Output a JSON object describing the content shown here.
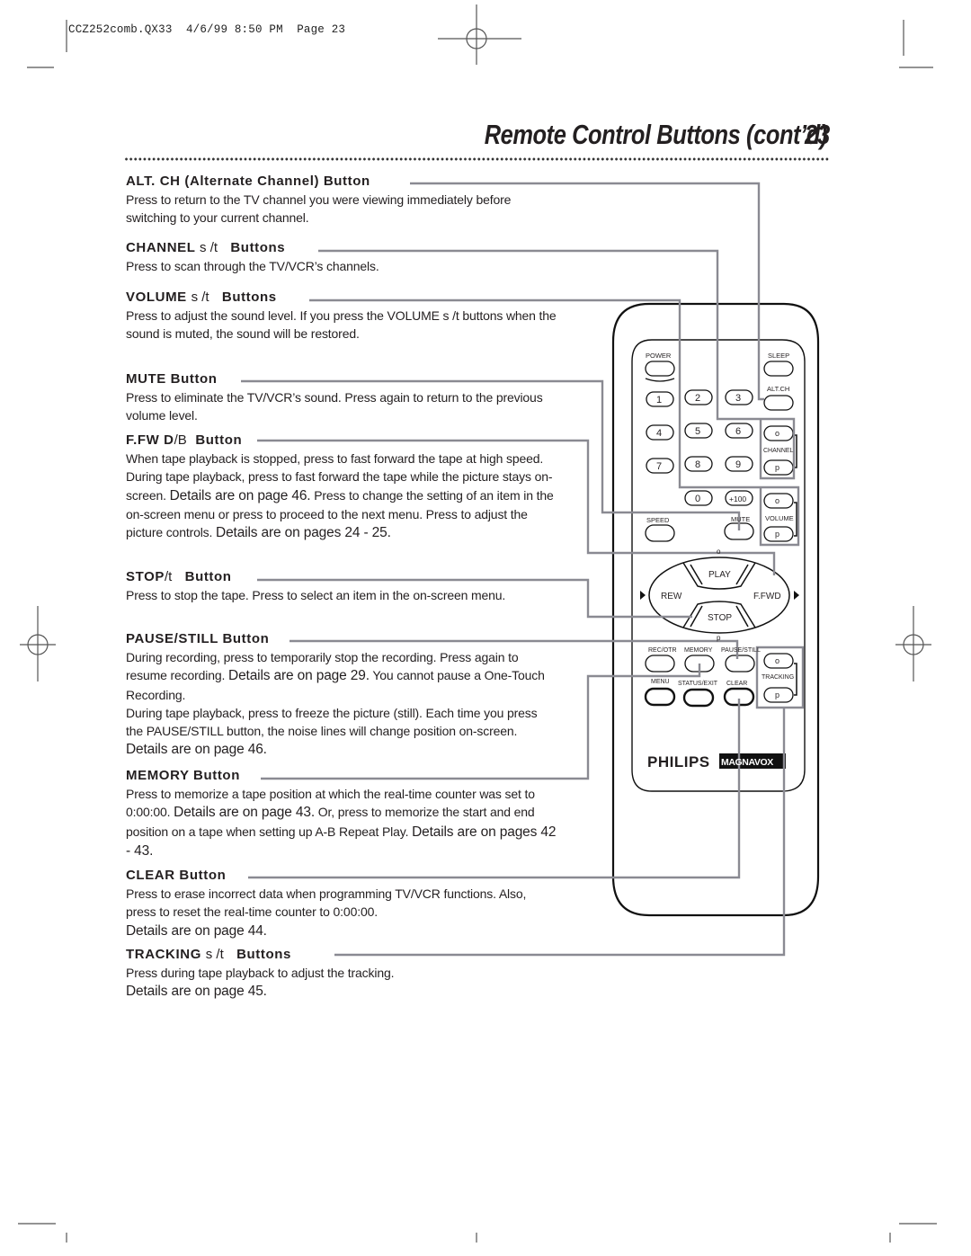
{
  "slug": {
    "file": "CCZ252comb.QX33",
    "date": "4/6/99",
    "time": "8:50 PM",
    "page_label": "Page 23"
  },
  "header": {
    "title": "Remote Control Buttons (cont’d)",
    "page_number": "23"
  },
  "sections": [
    {
      "heading": "ALT. CH (Alternate Channel) Button",
      "heading_symbol": "",
      "heading_suffix": "",
      "body": "Press to return to the TV channel you were viewing immediately before switching to your current channel.",
      "details": ""
    },
    {
      "heading": "CHANNEL",
      "heading_symbol": "s /t",
      "heading_suffix": "Buttons",
      "body": "Press to scan through the TV/VCR’s channels.",
      "details": ""
    },
    {
      "heading": "VOLUME",
      "heading_symbol": "s /t",
      "heading_suffix": "Buttons",
      "body": "Press to adjust the sound level. If you press the VOLUME s /t buttons when the sound is muted, the sound will be restored.",
      "details": ""
    },
    {
      "heading": "MUTE Button",
      "heading_symbol": "",
      "heading_suffix": "",
      "body": "Press to eliminate the TV/VCR’s sound. Press again to return to the previous volume level.",
      "details": ""
    },
    {
      "heading": "F.FW D",
      "heading_symbol": "/B",
      "heading_suffix": "Button",
      "body": "When tape playback is stopped, press to fast forward the tape at high speed.  During tape playback, press to fast forward the tape while the picture stays on-screen.",
      "details": "Details are on page 46.",
      "body2": "Press to change the setting of an item in the on-screen menu or press to proceed to the next menu. Press to adjust the picture controls.",
      "details2": "Details are on pages 24 - 25."
    },
    {
      "heading": "STOP",
      "heading_symbol": "/t",
      "heading_suffix": "Button",
      "body": "Press to stop the tape. Press to select an item in the on-screen menu.",
      "details": ""
    },
    {
      "heading": "PAUSE/STILL Button",
      "heading_symbol": "",
      "heading_suffix": "",
      "body": "During recording, press to temporarily stop the recording. Press again to resume recording.",
      "details": "Details are on page 29.",
      "body_tail": "You cannot pause a One-Touch Recording.",
      "body2": "During tape playback, press to freeze the picture (still). Each time you press the PAUSE/STILL button, the noise lines will change position on-screen.",
      "details2": "Details are on page 46."
    },
    {
      "heading": "MEMORY Button",
      "heading_symbol": "",
      "heading_suffix": "",
      "body": "Press to memorize a tape position at which the real-time counter was set to 0:00:00.",
      "details": "Details are on page 43.",
      "body_tail": "Or, press to memorize the start and end position on a tape when setting up A-B Repeat Play.",
      "details2": "Details are on pages 42 - 43."
    },
    {
      "heading": "CLEAR Button",
      "heading_symbol": "",
      "heading_suffix": "",
      "body": "Press to erase incorrect data when programming TV/VCR functions.  Also, press to reset the real-time counter to 0:00:00.",
      "details": "Details are on page 44."
    },
    {
      "heading": "TRACKING",
      "heading_symbol": "s /t",
      "heading_suffix": "Buttons",
      "body": "Press during tape playback to adjust the tracking.",
      "details": "Details are on page 45."
    }
  ],
  "remote": {
    "labels": {
      "power": "POWER",
      "sleep": "SLEEP",
      "alt_ch": "ALT.CH",
      "channel": "CHANNEL",
      "volume": "VOLUME",
      "speed": "SPEED",
      "mute": "MUTE",
      "play": "PLAY",
      "rew": "REW",
      "ffwd": "F.FWD",
      "stop": "STOP",
      "rec_otr": "REC/OTR",
      "memory": "MEMORY",
      "pause_still": "PAUSE/STILL",
      "menu": "MENU",
      "status_exit": "STATUS/EXIT",
      "clear": "CLEAR",
      "tracking": "TRACKING",
      "up_glyph": "o",
      "down_glyph": "p"
    },
    "number_keys": [
      "1",
      "2",
      "3",
      "4",
      "5",
      "6",
      "7",
      "8",
      "9",
      "0",
      "+100"
    ],
    "brand_philips": "PHILIPS",
    "brand_magnavox": "MAGNAVOX"
  }
}
